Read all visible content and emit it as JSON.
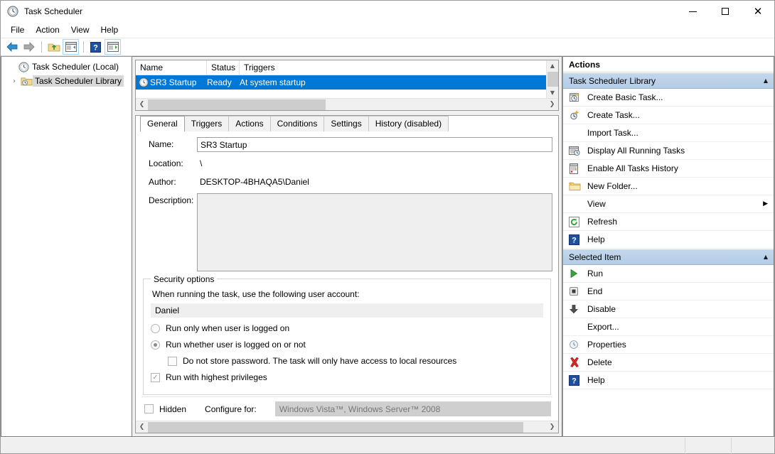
{
  "window": {
    "title": "Task Scheduler",
    "icon": "clock-icon",
    "minimize_label": "Minimize",
    "maximize_label": "Maximize",
    "close_label": "Close"
  },
  "menubar": {
    "items": [
      {
        "label": "File"
      },
      {
        "label": "Action"
      },
      {
        "label": "View"
      },
      {
        "label": "Help"
      }
    ]
  },
  "toolbar": {
    "buttons": [
      {
        "name": "back-icon",
        "tooltip": "Back"
      },
      {
        "name": "forward-icon",
        "tooltip": "Forward"
      },
      {
        "name": "up-folder-icon",
        "tooltip": "Up One Level"
      },
      {
        "name": "show-hide-console-tree-icon",
        "tooltip": "Show/Hide Console Tree"
      },
      {
        "name": "help-icon",
        "tooltip": "Help"
      },
      {
        "name": "show-hide-action-pane-icon",
        "tooltip": "Show/Hide Action Pane"
      }
    ]
  },
  "tree": {
    "nodes": [
      {
        "label": "Task Scheduler (Local)",
        "icon": "clock-icon",
        "selected": false,
        "expander": ""
      },
      {
        "label": "Task Scheduler Library",
        "icon": "folder-clock-icon",
        "selected": true,
        "expander": "›"
      }
    ]
  },
  "tasklist": {
    "columns": [
      "Name",
      "Status",
      "Triggers"
    ],
    "rows": [
      {
        "name": "SR3 Startup",
        "status": "Ready",
        "triggers": "At system startup",
        "selected": true,
        "icon": "clock-icon"
      }
    ]
  },
  "details": {
    "tabs": [
      {
        "label": "General",
        "active": true
      },
      {
        "label": "Triggers",
        "active": false
      },
      {
        "label": "Actions",
        "active": false
      },
      {
        "label": "Conditions",
        "active": false
      },
      {
        "label": "Settings",
        "active": false
      },
      {
        "label": "History (disabled)",
        "active": false
      }
    ],
    "general": {
      "name_label": "Name:",
      "name_value": "SR3 Startup",
      "location_label": "Location:",
      "location_value": "\\",
      "author_label": "Author:",
      "author_value": "DESKTOP-4BHAQA5\\Daniel",
      "description_label": "Description:",
      "description_value": "",
      "security": {
        "group_title": "Security options",
        "prompt": "When running the task, use the following user account:",
        "account": "Daniel",
        "radio_logged_on": "Run only when user is logged on",
        "radio_logged_on_checked": false,
        "radio_whether": "Run whether user is logged on or not",
        "radio_whether_checked": true,
        "check_no_password": "Do not store password.  The task will only have access to local resources",
        "check_no_password_checked": false,
        "check_highest": "Run with highest privileges",
        "check_highest_checked": true
      },
      "bottom": {
        "hidden_label": "Hidden",
        "hidden_checked": false,
        "configure_label": "Configure for:",
        "configure_value": "Windows Vista™, Windows Server™ 2008"
      }
    }
  },
  "actions": {
    "title": "Actions",
    "sections": [
      {
        "header": "Task Scheduler Library",
        "collapse_glyph": "▲",
        "items": [
          {
            "label": "Create Basic Task...",
            "icon": "create-basic-task-icon"
          },
          {
            "label": "Create Task...",
            "icon": "create-task-icon"
          },
          {
            "label": "Import Task...",
            "icon": ""
          },
          {
            "label": "Display All Running Tasks",
            "icon": "running-tasks-icon"
          },
          {
            "label": "Enable All Tasks History",
            "icon": "history-icon"
          },
          {
            "label": "New Folder...",
            "icon": "new-folder-icon"
          },
          {
            "label": "View",
            "icon": "",
            "submenu_arrow": "▶"
          },
          {
            "label": "Refresh",
            "icon": "refresh-icon"
          },
          {
            "label": "Help",
            "icon": "help-icon"
          }
        ]
      },
      {
        "header": "Selected Item",
        "collapse_glyph": "▲",
        "items": [
          {
            "label": "Run",
            "icon": "run-icon"
          },
          {
            "label": "End",
            "icon": "end-icon"
          },
          {
            "label": "Disable",
            "icon": "disable-icon"
          },
          {
            "label": "Export...",
            "icon": ""
          },
          {
            "label": "Properties",
            "icon": "properties-icon"
          },
          {
            "label": "Delete",
            "icon": "delete-icon"
          },
          {
            "label": "Help",
            "icon": "help-icon"
          }
        ]
      }
    ]
  },
  "colors": {
    "selection_blue": "#0078d7",
    "section_header_blue": "#b9d1e8",
    "accent_red": "#cc2222",
    "accent_green": "#2e9e2e"
  }
}
